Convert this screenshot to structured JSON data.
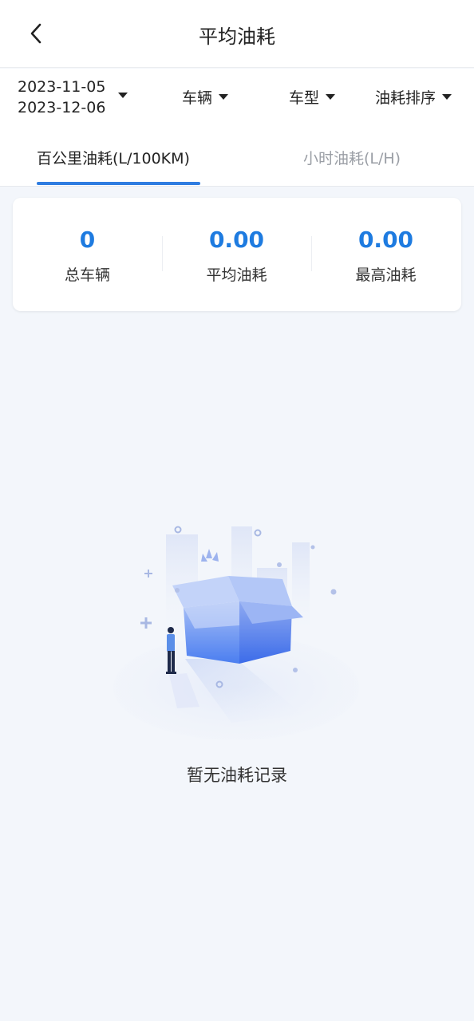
{
  "header": {
    "title": "平均油耗"
  },
  "filters": {
    "date_start": "2023-11-05",
    "date_end": "2023-12-06",
    "vehicle_label": "车辆",
    "model_label": "车型",
    "sort_label": "油耗排序"
  },
  "tabs": [
    {
      "label": "百公里油耗(L/100KM)",
      "active": true
    },
    {
      "label": "小时油耗(L/H)",
      "active": false
    }
  ],
  "stats": [
    {
      "value": "0",
      "label": "总车辆"
    },
    {
      "value": "0.00",
      "label": "平均油耗"
    },
    {
      "value": "0.00",
      "label": "最高油耗"
    }
  ],
  "empty": {
    "message": "暂无油耗记录",
    "icon": "empty-box-illustration"
  },
  "colors": {
    "accent": "#1e7be0",
    "tab_indicator": "#2f7de1",
    "background": "#f3f6fb"
  }
}
